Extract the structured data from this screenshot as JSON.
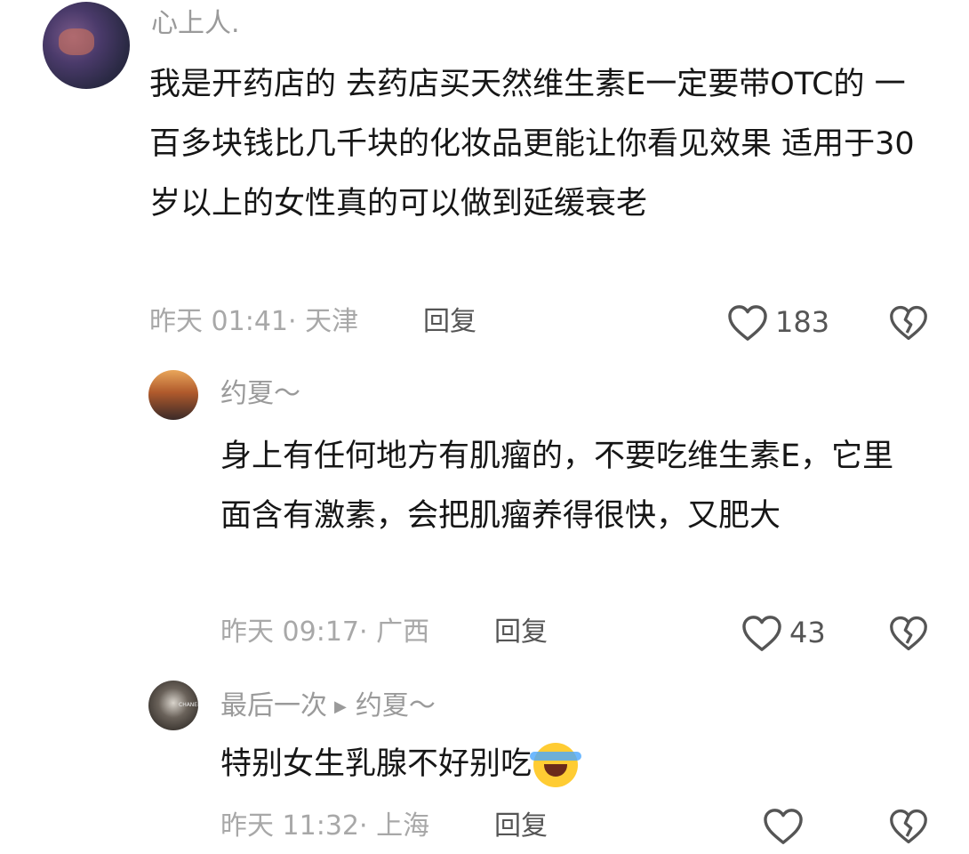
{
  "comments": [
    {
      "username": "心上人.",
      "text": "我是开药店的 去药店买天然维生素E一定要带OTC的 一百多块钱比几千块的化妆品更能让你看见效果 适用于30岁以上的女性真的可以做到延缓衰老",
      "meta": "昨天 01:41· 天津",
      "reply_label": "回复",
      "likes": "183"
    },
    {
      "username": "约夏～",
      "text": "身上有任何地方有肌瘤的，不要吃维生素E，它里面含有激素，会把肌瘤养得很快，又肥大",
      "meta": "昨天 09:17· 广西",
      "reply_label": "回复",
      "likes": "43"
    },
    {
      "username": "最后一次",
      "reply_to": "约夏～",
      "text": "特别女生乳腺不好别吃",
      "meta": "昨天 11:32· 上海",
      "reply_label": "回复"
    }
  ],
  "icons": {
    "like": "heart-outline-icon",
    "dislike": "broken-heart-icon",
    "reply_arrow": "play-arrow-icon",
    "emoji": "laughing-crying-emoji"
  },
  "colors": {
    "text": "#161616",
    "muted": "#a8a8a8",
    "name": "#9a9a9a",
    "action": "#555555"
  }
}
